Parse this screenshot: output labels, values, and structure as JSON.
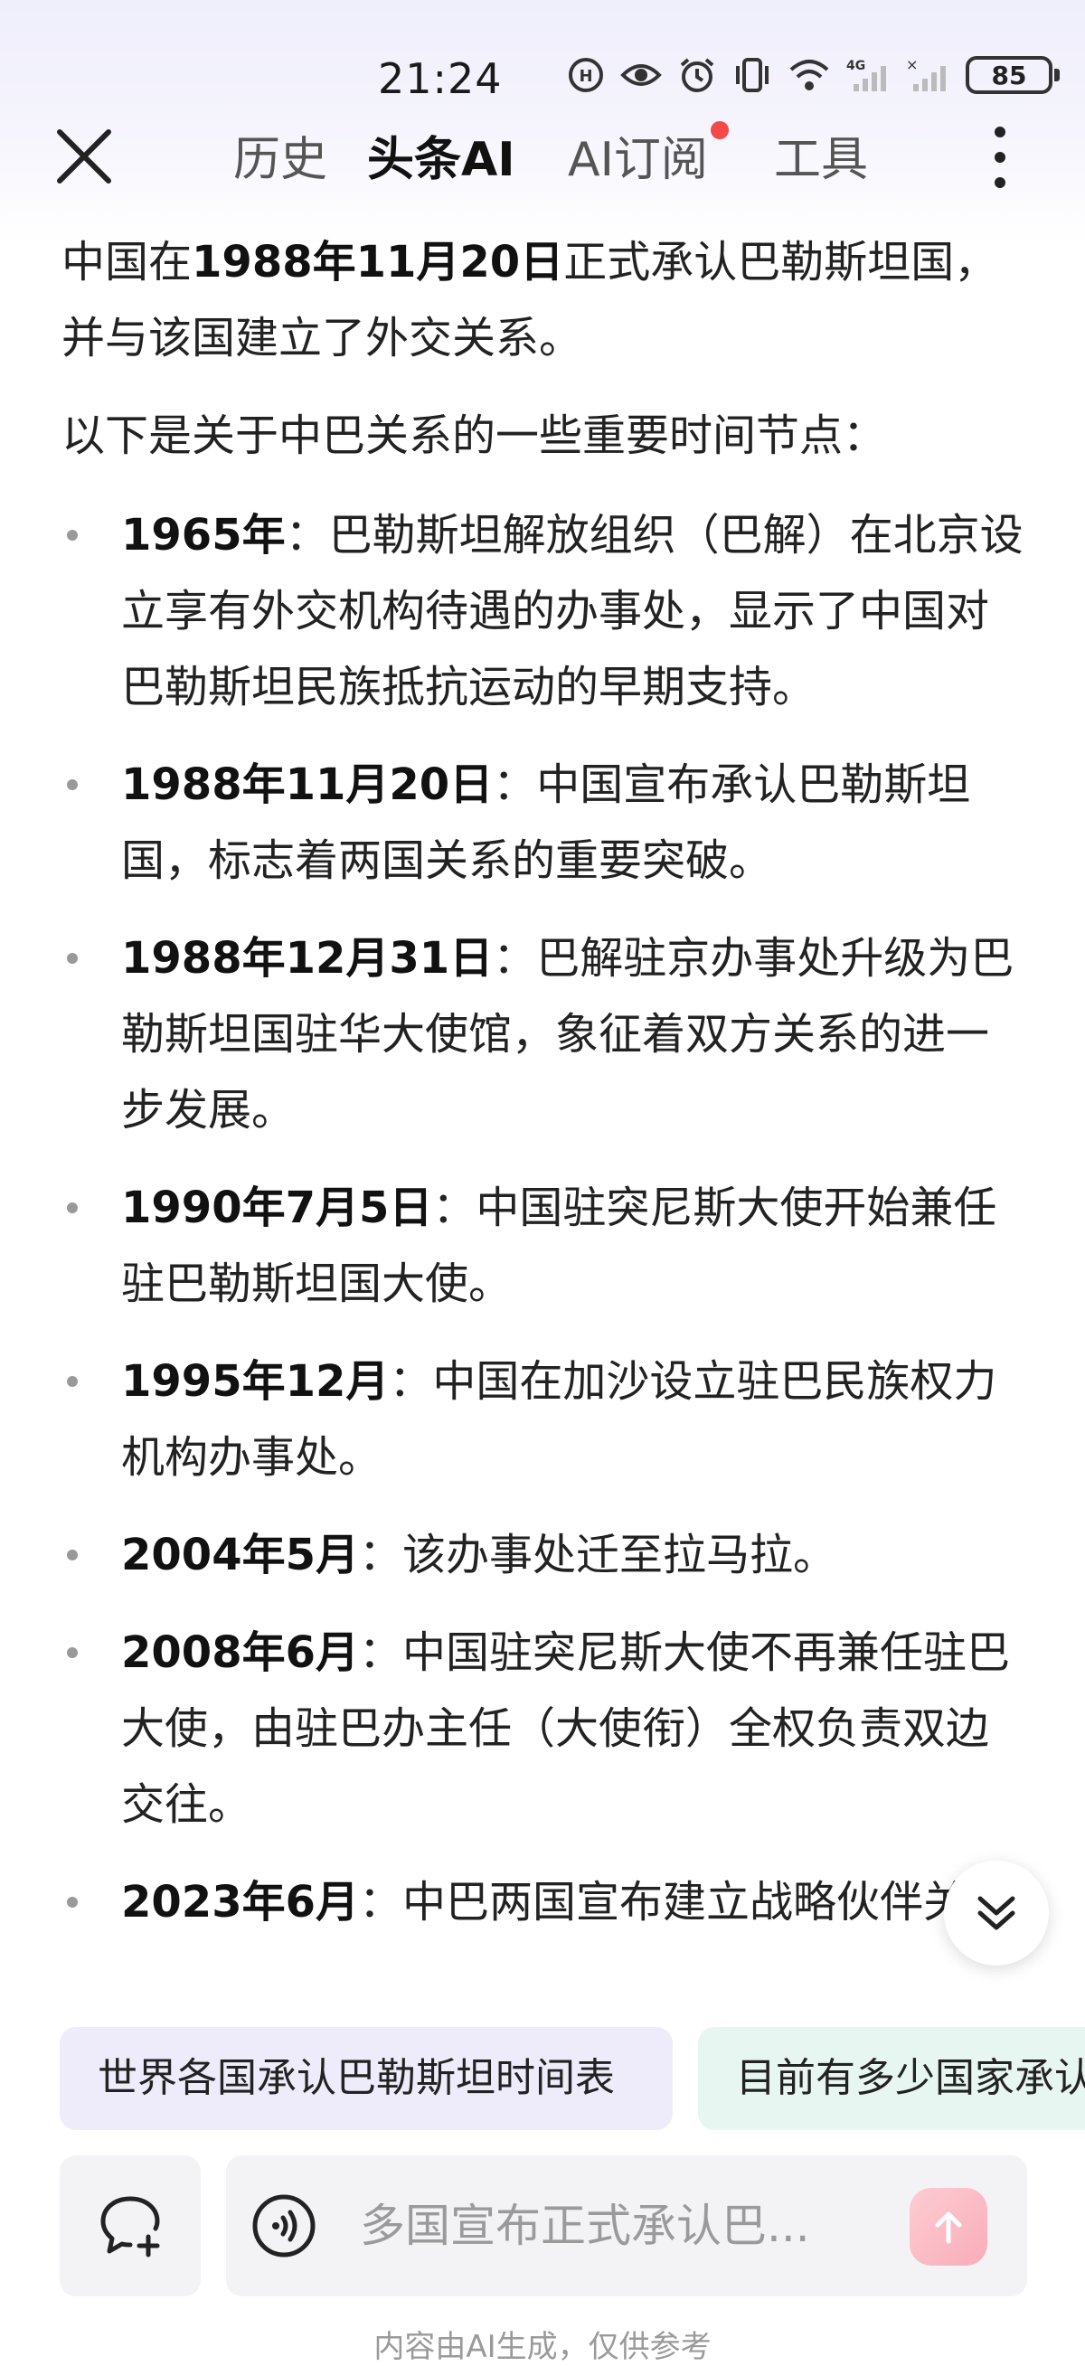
{
  "status_bar": {
    "time": "21:24",
    "battery": "85",
    "icons": [
      "hd-icon",
      "eye-icon",
      "alarm-icon",
      "vibrate-icon",
      "wifi-icon",
      "signal-4g-icon",
      "signal-icon",
      "battery-icon"
    ]
  },
  "nav": {
    "tabs": [
      {
        "label": "历史",
        "active": false
      },
      {
        "label": "头条AI",
        "active": true
      },
      {
        "label": "AI订阅",
        "active": false,
        "badge": true
      },
      {
        "label": "工具",
        "active": false
      }
    ],
    "close_icon": "close-icon",
    "more_icon": "more-vertical-icon",
    "badge_color": "#f5484a"
  },
  "content": {
    "intro": {
      "pre": "中国在",
      "bold": "1988年11月20日",
      "post": "正式承认巴勒斯坦国，并与该国建立了外交关系。"
    },
    "intro2": "以下是关于中巴关系的一些重要时间节点：",
    "timeline": [
      {
        "date": "1965年",
        "text": "：巴勒斯坦解放组织（巴解）在北京设立享有外交机构待遇的办事处，显示了中国对巴勒斯坦民族抵抗运动的早期支持。"
      },
      {
        "date": "1988年11月20日",
        "text": "：中国宣布承认巴勒斯坦国，标志着两国关系的重要突破。"
      },
      {
        "date": "1988年12月31日",
        "text": "：巴解驻京办事处升级为巴勒斯坦国驻华大使馆，象征着双方关系的进一步发展。"
      },
      {
        "date": "1990年7月5日",
        "text": "：中国驻突尼斯大使开始兼任驻巴勒斯坦国大使。"
      },
      {
        "date": "1995年12月",
        "text": "：中国在加沙设立驻巴民族权力机构办事处。"
      },
      {
        "date": "2004年5月",
        "text": "：该办事处迁至拉马拉。"
      },
      {
        "date": "2008年6月",
        "text": "：中国驻突尼斯大使不再兼任驻巴大使，由驻巴办主任（大使衔）全权负责双边交往。"
      },
      {
        "date": "2023年6月",
        "text": "：中巴两国宣布建立战略伙伴关系"
      }
    ]
  },
  "suggestions": [
    {
      "label": "世界各国承认巴勒斯坦时间表"
    },
    {
      "label": "目前有多少国家承认"
    }
  ],
  "input": {
    "placeholder": "多国宣布正式承认巴...",
    "new_chat_icon": "new-chat-icon",
    "voice_icon": "voice-icon",
    "send_icon": "send-arrow-icon"
  },
  "disclaimer": "内容由AI生成，仅供参考"
}
